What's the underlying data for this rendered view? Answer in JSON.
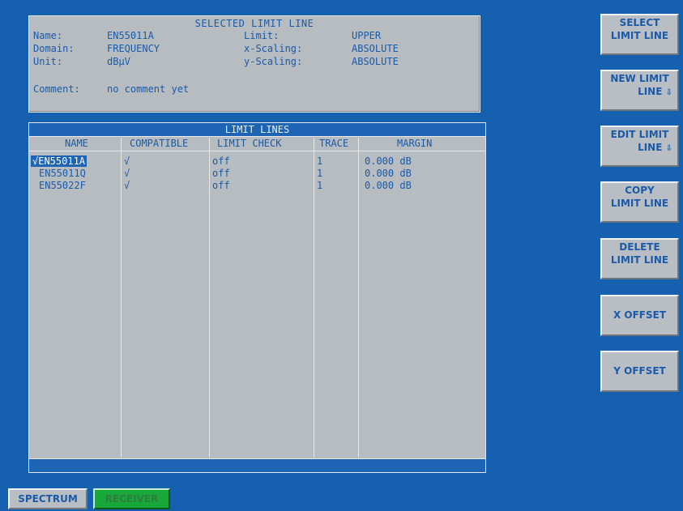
{
  "selected_limit_line": {
    "title": "SELECTED LIMIT LINE",
    "name_label": "Name:",
    "name_value": "EN55011A",
    "domain_label": "Domain:",
    "domain_value": "FREQUENCY",
    "unit_label": "Unit:",
    "unit_value": "dBµV",
    "limit_label": "Limit:",
    "limit_value": "UPPER",
    "xscaling_label": "x-Scaling:",
    "xscaling_value": "ABSOLUTE",
    "yscaling_label": "y-Scaling:",
    "yscaling_value": "ABSOLUTE",
    "comment_label": "Comment:",
    "comment_value": "no comment yet"
  },
  "limit_lines": {
    "title": "LIMIT LINES",
    "headers": {
      "name": "NAME",
      "compatible": "COMPATIBLE",
      "limit_check": "LIMIT CHECK",
      "trace": "TRACE",
      "margin": "MARGIN"
    },
    "rows": [
      {
        "name": "√EN55011A",
        "compatible": "√",
        "limit_check": "off",
        "trace": "1",
        "margin": "0.000 dB"
      },
      {
        "name": "EN55011Q",
        "compatible": "√",
        "limit_check": "off",
        "trace": "1",
        "margin": "0.000 dB"
      },
      {
        "name": "EN55022F",
        "compatible": "√",
        "limit_check": "off",
        "trace": "1",
        "margin": "0.000 dB"
      }
    ]
  },
  "softkeys": {
    "select_limit_line": {
      "line1": "SELECT",
      "line2": "LIMIT LINE"
    },
    "new_limit_line": {
      "line1": "NEW LIMIT",
      "line2": "LINE"
    },
    "edit_limit_line": {
      "line1": "EDIT LIMIT",
      "line2": "LINE"
    },
    "copy_limit_line": {
      "line1": "COPY",
      "line2": "LIMIT LINE"
    },
    "delete_limit_line": {
      "line1": "DELETE",
      "line2": "LIMIT LINE"
    },
    "x_offset": {
      "line1": "X OFFSET"
    },
    "y_offset": {
      "line1": "Y OFFSET"
    }
  },
  "hotkeys": {
    "spectrum": "SPECTRUM",
    "receiver": "RECEIVER"
  },
  "colors": {
    "background": "#1660b0",
    "panel": "#b7bcc1",
    "text": "#1a5aa8",
    "receiver_active": "#18a83a"
  }
}
